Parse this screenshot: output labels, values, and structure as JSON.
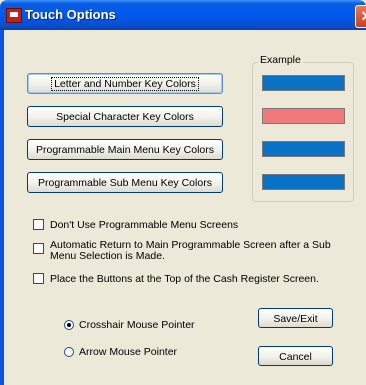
{
  "window": {
    "title": "Touch Options",
    "close_symbol": "✕"
  },
  "color_buttons": [
    {
      "label": "Letter and Number Key Colors"
    },
    {
      "label": "Special Character Key Colors"
    },
    {
      "label": "Programmable Main Menu Key Colors"
    },
    {
      "label": "Programmable Sub Menu Key Colors"
    }
  ],
  "example": {
    "label": "Example",
    "swatch_colors": [
      "#0a72c4",
      "#f07a7a",
      "#0a72c4",
      "#0a72c4"
    ]
  },
  "options": [
    {
      "label": "Don't Use Programmable Menu Screens",
      "checked": false
    },
    {
      "label_line1": "Automatic Return to Main Programmable Screen after a Sub",
      "label_line2": "Menu Selection is Made.",
      "checked": false
    },
    {
      "label": "Place the Buttons at the Top of the Cash Register Screen.",
      "checked": false
    }
  ],
  "pointer": {
    "options": [
      {
        "label": "Crosshair Mouse Pointer",
        "selected": true
      },
      {
        "label": "Arrow Mouse Pointer",
        "selected": false
      }
    ]
  },
  "actions": {
    "save_label": "Save/Exit",
    "cancel_label": "Cancel"
  }
}
